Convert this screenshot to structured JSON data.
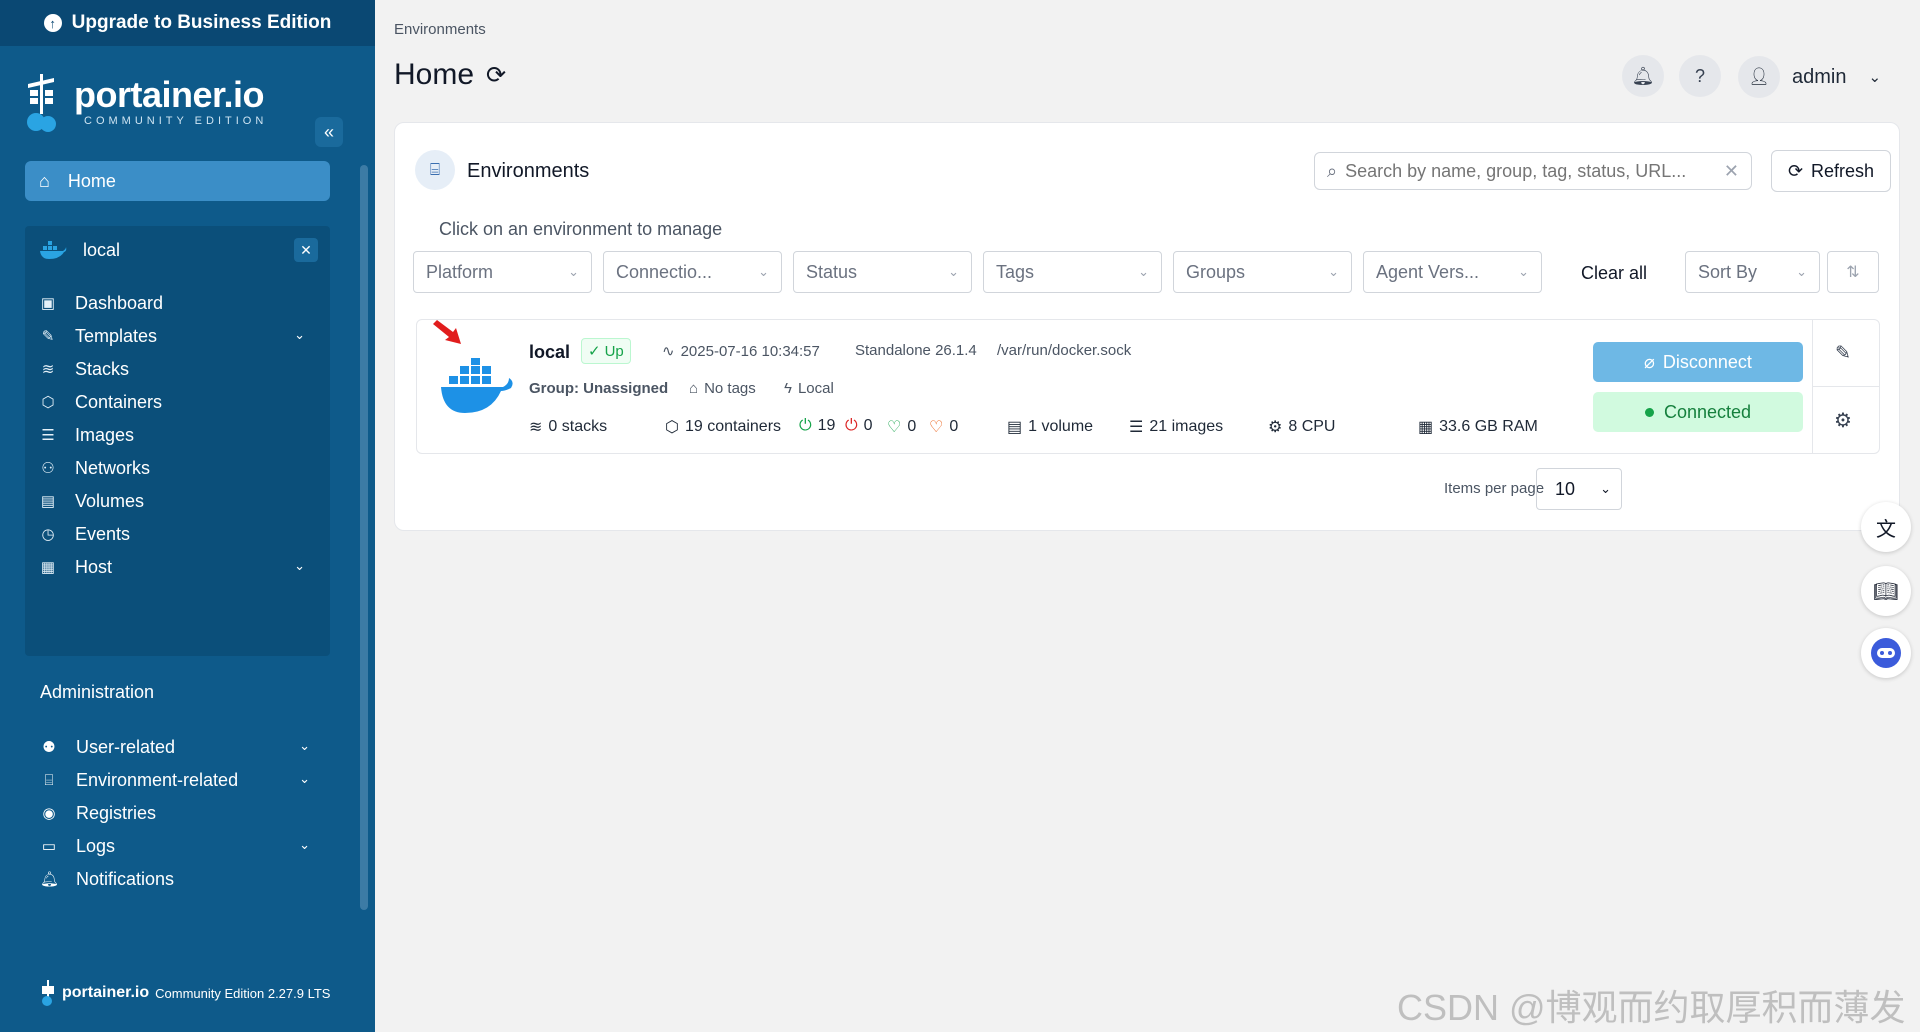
{
  "sidebar": {
    "upgrade_label": "Upgrade to Business Edition",
    "logo_text": "portainer.io",
    "logo_sub": "COMMUNITY EDITION",
    "home_label": "Home",
    "environment": {
      "name": "local",
      "items": [
        {
          "label": "Dashboard",
          "icon": "dashboard-icon"
        },
        {
          "label": "Templates",
          "icon": "edit-icon"
        },
        {
          "label": "Stacks",
          "icon": "layers-icon"
        },
        {
          "label": "Containers",
          "icon": "box-icon"
        },
        {
          "label": "Images",
          "icon": "list-icon"
        },
        {
          "label": "Networks",
          "icon": "network-icon"
        },
        {
          "label": "Volumes",
          "icon": "database-icon"
        },
        {
          "label": "Events",
          "icon": "clock-icon"
        },
        {
          "label": "Host",
          "icon": "host-icon"
        }
      ]
    },
    "admin_title": "Administration",
    "admin_items": [
      {
        "label": "User-related",
        "icon": "users-icon"
      },
      {
        "label": "Environment-related",
        "icon": "hdd-icon"
      },
      {
        "label": "Registries",
        "icon": "radio-icon"
      },
      {
        "label": "Logs",
        "icon": "file-icon"
      },
      {
        "label": "Notifications",
        "icon": "bell-icon"
      }
    ],
    "footer": {
      "brand": "portainer.io",
      "version": "Community Edition 2.27.9 LTS"
    }
  },
  "header": {
    "breadcrumb": "Environments",
    "title": "Home",
    "user": "admin"
  },
  "panel": {
    "title": "Environments",
    "search_placeholder": "Search by name, group, tag, status, URL...",
    "refresh_label": "Refresh",
    "hint": "Click on an environment to manage",
    "filters": [
      "Platform",
      "Connectio...",
      "Status",
      "Tags",
      "Groups",
      "Agent Vers..."
    ],
    "clear_all": "Clear all",
    "sort_by": "Sort By",
    "items_per_page_label": "Items per page",
    "items_per_page": "10"
  },
  "environment_card": {
    "name": "local",
    "status": "Up",
    "timestamp": "2025-07-16 10:34:57",
    "type": "Standalone 26.1.4",
    "url": "/var/run/docker.sock",
    "group": "Group: Unassigned",
    "tags": "No tags",
    "locality": "Local",
    "stacks": "0 stacks",
    "containers": "19 containers",
    "running": "19",
    "stopped": "0",
    "healthy": "0",
    "unhealthy": "0",
    "volumes": "1 volume",
    "images": "21 images",
    "cpu": "8 CPU",
    "ram": "33.6 GB RAM",
    "disconnect_label": "Disconnect",
    "connected_label": "Connected"
  },
  "watermark": "CSDN @博观而约取厚积而薄发",
  "colors": {
    "sidebar_bg": "#0e5a8a",
    "accent": "#3b8ec7",
    "disconnect": "#6eb8e5",
    "connected": "#16a34a"
  }
}
